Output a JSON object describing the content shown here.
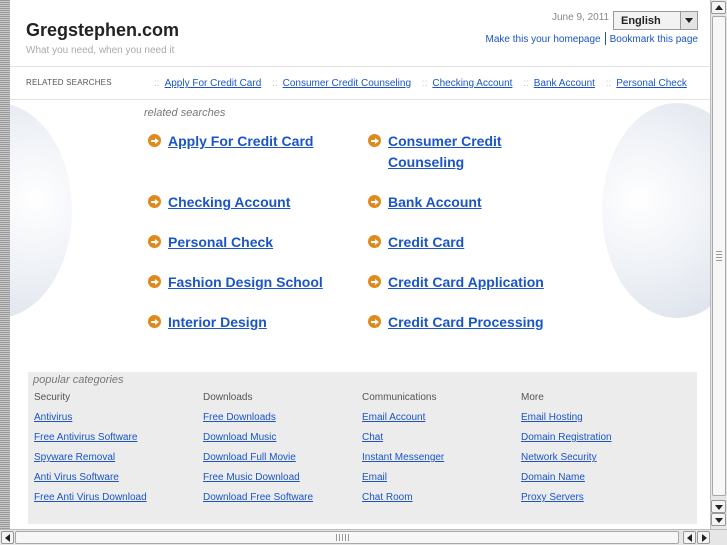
{
  "header": {
    "site_title": "Gregstephen.com",
    "tagline": "What you need, when you need it",
    "date": "June 9, 2011",
    "language": "English",
    "make_homepage": "Make this your homepage",
    "bookmark": "Bookmark this page"
  },
  "related_bar": {
    "label": "RELATED SEARCHES",
    "separator": "::",
    "links": [
      "Apply For Credit Card",
      "Consumer Credit Counseling",
      "Checking Account",
      "Bank Account",
      "Personal Check"
    ]
  },
  "related_searches": {
    "title": "related searches",
    "items": [
      {
        "line1": "Apply For Credit Card",
        "line2": ""
      },
      {
        "line1": "Consumer Credit",
        "line2": "Counseling"
      },
      {
        "line1": "Checking Account",
        "line2": ""
      },
      {
        "line1": "Bank Account",
        "line2": ""
      },
      {
        "line1": "Personal Check",
        "line2": ""
      },
      {
        "line1": "Credit Card",
        "line2": ""
      },
      {
        "line1": "Fashion Design School",
        "line2": ""
      },
      {
        "line1": "Credit Card Application",
        "line2": ""
      },
      {
        "line1": "Interior Design",
        "line2": ""
      },
      {
        "line1": "Credit Card Processing",
        "line2": ""
      }
    ]
  },
  "popular": {
    "title": "popular categories",
    "columns": [
      {
        "heading": "Security",
        "links": [
          "Antivirus",
          "Free Antivirus Software",
          "Spyware Removal",
          "Anti Virus Software",
          "Free Anti Virus Download"
        ]
      },
      {
        "heading": "Downloads",
        "links": [
          "Free Downloads",
          "Download Music",
          "Download Full Movie",
          "Free Music Download",
          "Download Free Software"
        ]
      },
      {
        "heading": "Communications",
        "links": [
          "Email Account",
          "Chat",
          "Instant Messenger",
          "Email",
          "Chat Room"
        ]
      },
      {
        "heading": "More",
        "links": [
          "Email Hosting",
          "Domain Registration",
          "Network Security",
          "Domain Name",
          "Proxy Servers"
        ]
      }
    ]
  },
  "colors": {
    "link": "#1a55c8",
    "arrow_bullet": "#e08a1c",
    "panel_bg": "#ececec"
  }
}
